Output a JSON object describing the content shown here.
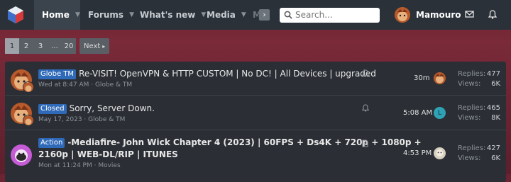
{
  "nav": {
    "tabs": [
      {
        "label": "Home",
        "active": true
      },
      {
        "label": "Forums"
      },
      {
        "label": "What's new"
      },
      {
        "label": "Media"
      },
      {
        "label": "M"
      }
    ],
    "search_placeholder": "Search...",
    "username": "Mamouro",
    "icons": [
      "logo-icon",
      "scroll-right-icon",
      "search-icon",
      "envelope-icon",
      "bell-icon"
    ]
  },
  "pagination": {
    "pages": [
      "1",
      "2",
      "3",
      "...",
      "20"
    ],
    "current": "1",
    "next_label": "Next"
  },
  "threads": [
    {
      "prefix": "Globe TM",
      "title": "Re-VISIT! OpenVPN & HTTP CUSTOM | No DC! | All Devices | upgraded",
      "meta": "Wed at 8:47 AM · Globe & TM",
      "last_time": "30m",
      "replies_label": "Replies:",
      "replies": "477",
      "views_label": "Views:",
      "views": "6K",
      "bold": false,
      "icon": "bell-icon"
    },
    {
      "prefix": "Closed",
      "title": "Sorry, Server Down.",
      "meta": "May 17, 2023 · Globe & TM",
      "last_time": "5:08 AM",
      "last_avatar_letter": "L",
      "replies_label": "Replies:",
      "replies": "465",
      "views_label": "Views:",
      "views": "8K",
      "bold": false,
      "icon": "bell-icon"
    },
    {
      "prefix": "Action",
      "title_line1": "-Mediafire- John Wick Chapter 4 (2023) | 60FPS + Ds4K + 720p + 1080p +",
      "title_line2": "2160p | WEB-DL/RIP | ITUNES",
      "meta": "Mon at 11:24 PM · Movies",
      "last_time": "4:53 PM",
      "replies_label": "Replies:",
      "replies": "427",
      "views_label": "Views:",
      "views": "6K",
      "bold": true,
      "icon": "document-icon"
    }
  ],
  "colors": {
    "nav_bg": "#2a3139",
    "background": "#6b2331",
    "panel_bg": "#2b2f35",
    "badge_blue": "#2f6ab8"
  }
}
